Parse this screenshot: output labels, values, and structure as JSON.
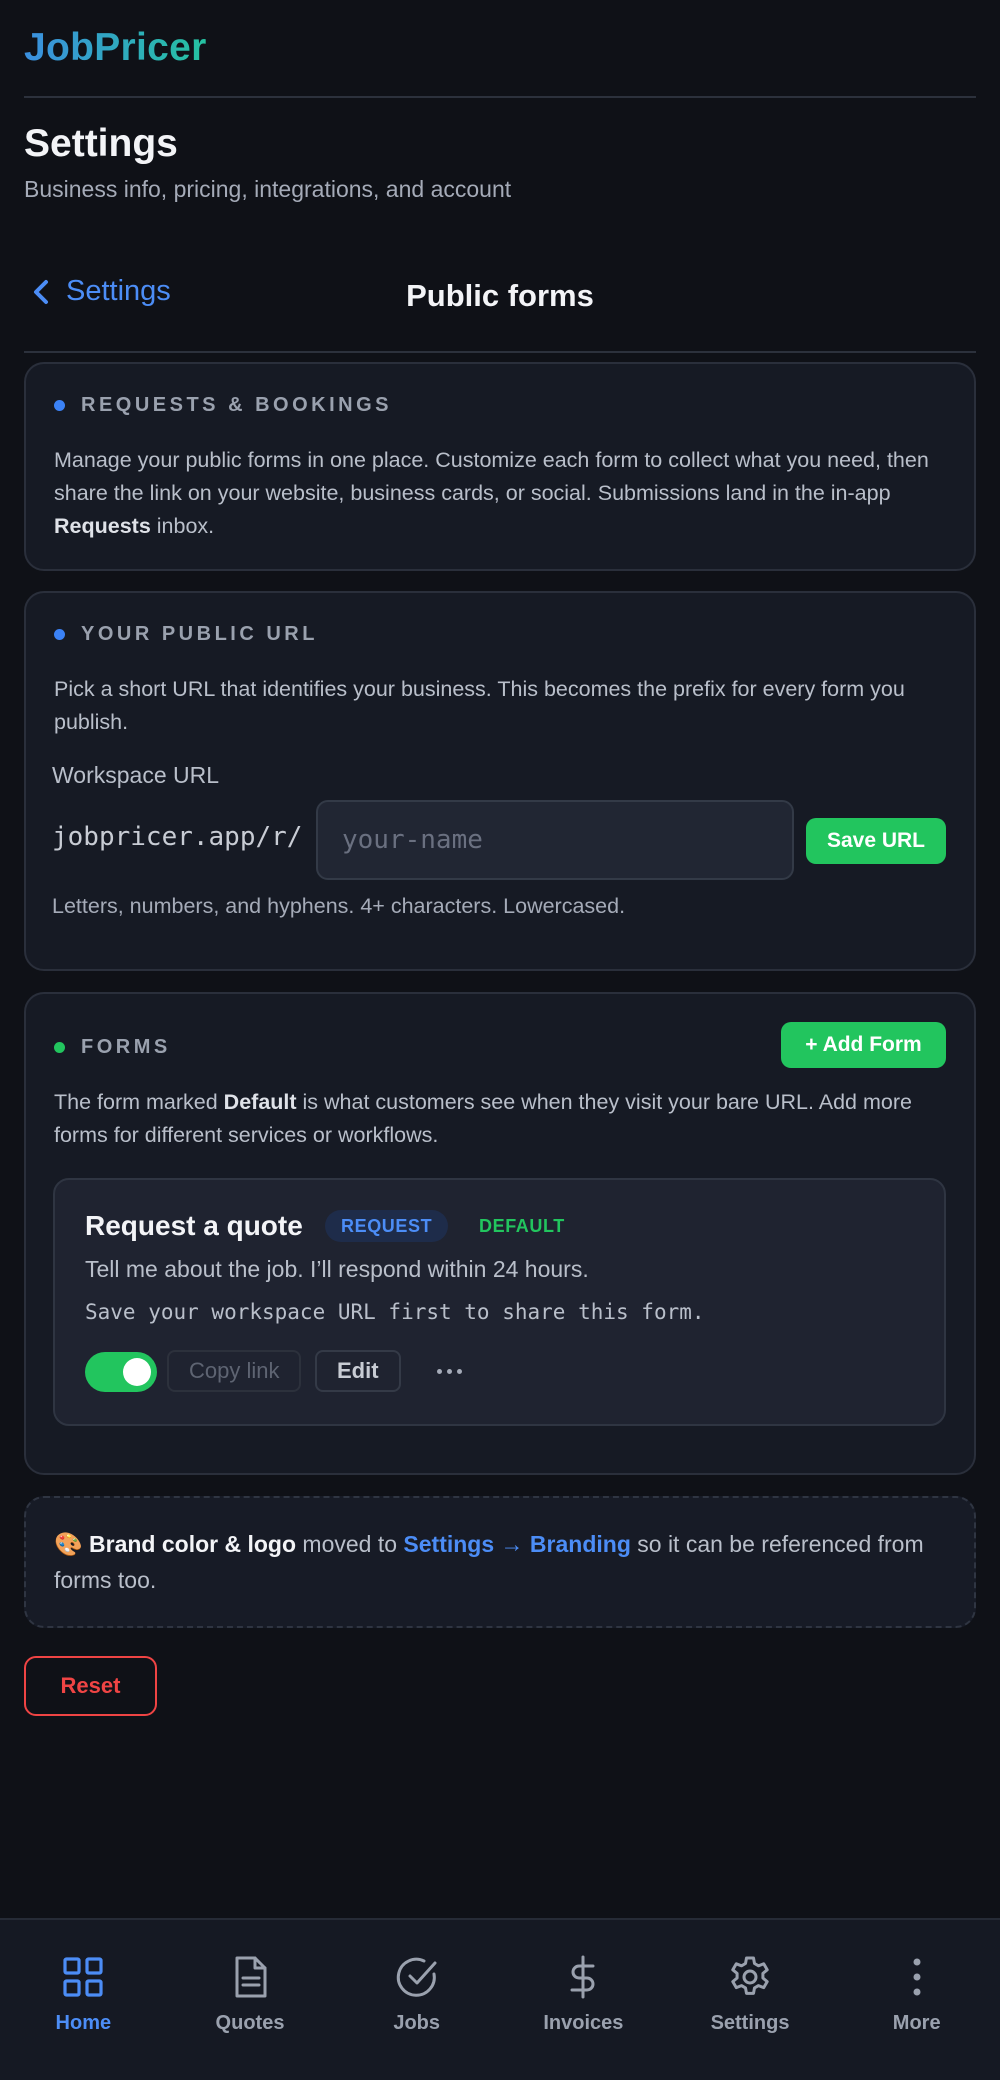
{
  "app": {
    "brand": "JobPricer"
  },
  "header": {
    "title": "Settings",
    "subtitle": "Business info, pricing, integrations, and account"
  },
  "subnav": {
    "back_label": "Settings",
    "title": "Public forms"
  },
  "requests_card": {
    "label": "REQUESTS & BOOKINGS",
    "text_before": "Manage your public forms in one place. Customize each form to collect what you need, then share the link on your website, business cards, or social. Submissions land in the in-app ",
    "text_bold": "Requests",
    "text_after": " inbox.",
    "dot_color": "#3b82f6"
  },
  "url_card": {
    "label": "YOUR PUBLIC URL",
    "text": "Pick a short URL that identifies your business. This becomes the prefix for every form you publish.",
    "field_label": "Workspace URL",
    "prefix": "jobpricer.app/r/",
    "input_value": "",
    "input_placeholder": "your-name",
    "save_label": "Save URL",
    "hint": "Letters, numbers, and hyphens. 4+ characters. Lowercased.",
    "dot_color": "#3b82f6"
  },
  "forms_card": {
    "label": "FORMS",
    "add_label": "+ Add Form",
    "text_before": "The form marked ",
    "text_bold": "Default",
    "text_after": " is what customers see when they visit your bare URL. Add more forms for different services or workflows.",
    "dot_color": "#22c55e",
    "forms": [
      {
        "title": "Request a quote",
        "type_badge": "REQUEST",
        "default_badge": "DEFAULT",
        "description": "Tell me about the job. I’ll respond within 24 hours.",
        "note": "Save your workspace URL first to share this form.",
        "enabled": true,
        "copy_label": "Copy link",
        "edit_label": "Edit"
      }
    ]
  },
  "brand_note": {
    "emoji": "🎨",
    "bold": "Brand color & logo",
    "text_mid": " moved to ",
    "link": "Settings → Branding",
    "text_after": " so it can be referenced from forms too."
  },
  "reset_label": "Reset",
  "bottom_nav": {
    "active": "Home",
    "items": [
      {
        "label": "Home",
        "icon": "grid-icon"
      },
      {
        "label": "Quotes",
        "icon": "document-icon"
      },
      {
        "label": "Jobs",
        "icon": "check-circle-icon"
      },
      {
        "label": "Invoices",
        "icon": "dollar-icon"
      },
      {
        "label": "Settings",
        "icon": "gear-icon"
      },
      {
        "label": "More",
        "icon": "more-vertical-icon"
      }
    ]
  },
  "colors": {
    "accent_blue": "#4c8df6",
    "success_green": "#22c55e",
    "danger_red": "#ef4444",
    "background": "#0f1117"
  }
}
